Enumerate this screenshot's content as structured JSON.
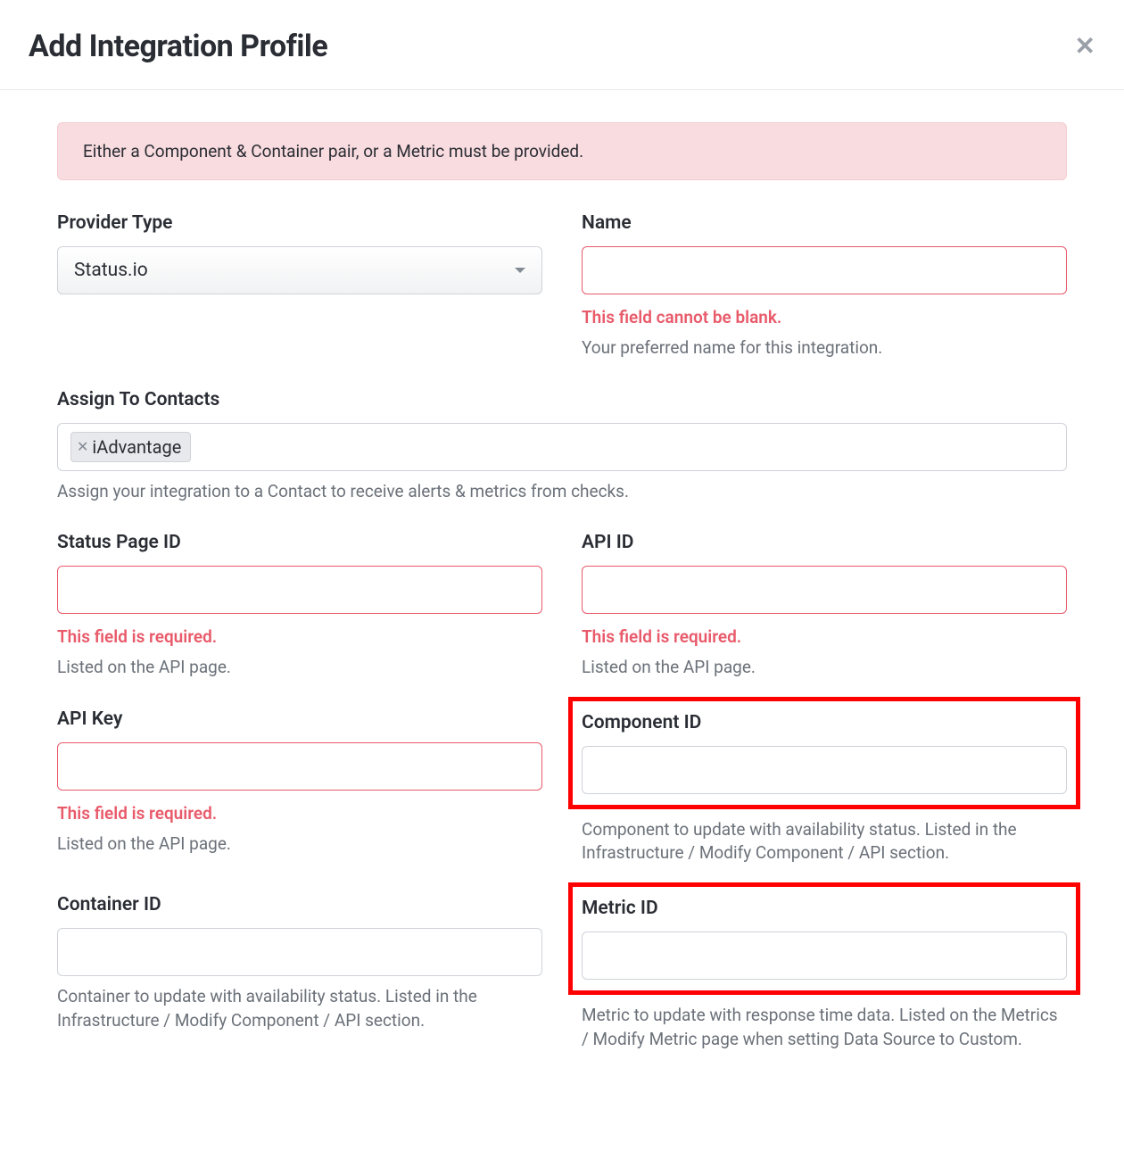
{
  "header": {
    "title": "Add Integration Profile"
  },
  "alert": {
    "message": "Either a Component & Container pair, or a Metric must be provided."
  },
  "fields": {
    "provider_type": {
      "label": "Provider Type",
      "value": "Status.io"
    },
    "name": {
      "label": "Name",
      "value": "",
      "error": "This field cannot be blank.",
      "help": "Your preferred name for this integration."
    },
    "assign_to_contacts": {
      "label": "Assign To Contacts",
      "tags": [
        "iAdvantage"
      ],
      "help": "Assign your integration to a Contact to receive alerts & metrics from checks."
    },
    "status_page_id": {
      "label": "Status Page ID",
      "value": "",
      "error": "This field is required.",
      "help": "Listed on the API page."
    },
    "api_id": {
      "label": "API ID",
      "value": "",
      "error": "This field is required.",
      "help": "Listed on the API page."
    },
    "api_key": {
      "label": "API Key",
      "value": "",
      "error": "This field is required.",
      "help": "Listed on the API page."
    },
    "component_id": {
      "label": "Component ID",
      "value": "",
      "help": "Component to update with availability status. Listed in the Infrastructure / Modify Component / API section."
    },
    "container_id": {
      "label": "Container ID",
      "value": "",
      "help": "Container to update with availability status. Listed in the Infrastructure / Modify Component / API section."
    },
    "metric_id": {
      "label": "Metric ID",
      "value": "",
      "help": "Metric to update with response time data. Listed on the Metrics / Modify Metric page when setting Data Source to Custom."
    }
  }
}
